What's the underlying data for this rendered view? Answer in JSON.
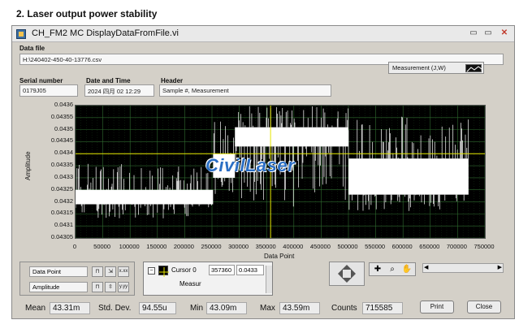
{
  "doc": {
    "heading": "2.   Laser output power stability"
  },
  "window": {
    "title": "CH_FM2 MC DisplayDataFromFile.vi",
    "minimize_glyph": "▭",
    "maximize_glyph": "▭",
    "close_glyph": "✕"
  },
  "data_file": {
    "label": "Data file",
    "path": "H:\\240402-450-40-13776.csv"
  },
  "info": {
    "serial_label": "Serial number",
    "serial": "0179J05",
    "date_label": "Date and Time",
    "date": "2024 四月 02 12:29",
    "header_label": "Header",
    "header": "Sample #, Measurement"
  },
  "plot_legend": {
    "label": "Measurement (J,W)"
  },
  "watermark": "CivilLaser",
  "chart_data": {
    "type": "line",
    "xlabel": "Data Point",
    "ylabel": "Amplitude",
    "xlim": [
      0,
      750000
    ],
    "ylim": [
      0.04305,
      0.0436
    ],
    "x_ticks": [
      "0",
      "50000",
      "100000",
      "150000",
      "200000",
      "250000",
      "300000",
      "350000",
      "400000",
      "450000",
      "500000",
      "550000",
      "600000",
      "650000",
      "700000",
      "750000"
    ],
    "y_ticks": [
      "0.0436",
      "0.04355",
      "0.0435",
      "0.04345",
      "0.0434",
      "0.04335",
      "0.0433",
      "0.04325",
      "0.0432",
      "0.04315",
      "0.0431",
      "0.04305"
    ],
    "grid": true,
    "cursor": {
      "x": 357360,
      "y": 0.0434
    },
    "series": [
      {
        "color": "#ffffff",
        "segments": [
          {
            "x": [
              0,
              252000
            ],
            "range": [
              0.04313,
              0.04336
            ],
            "dense": [
              0.04319,
              0.04325
            ]
          },
          {
            "x": [
              252000,
              292000
            ],
            "range": [
              0.04322,
              0.04354
            ],
            "dense": [
              0.0433,
              0.0434
            ]
          },
          {
            "x": [
              292000,
              500000
            ],
            "range": [
              0.04318,
              0.0436
            ],
            "dense": [
              0.04343,
              0.04351
            ]
          },
          {
            "x": [
              500000,
              720000
            ],
            "range": [
              0.04316,
              0.04356
            ],
            "dense": [
              0.04323,
              0.04338
            ]
          }
        ]
      }
    ]
  },
  "scale_legend": {
    "x_name": "Data Point",
    "y_name": "Amplitude"
  },
  "cursor_legend": {
    "name": "Cursor 0",
    "x_value": "357360",
    "y_value": "0.0433",
    "plot": "Measur"
  },
  "stats": {
    "mean_label": "Mean",
    "mean": "43.31m",
    "std_label": "Std. Dev.",
    "std": "94.55u",
    "min_label": "Min",
    "min": "43.09m",
    "max_label": "Max",
    "max": "43.59m",
    "counts_label": "Counts",
    "counts": "715585"
  },
  "buttons": {
    "print": "Print",
    "close": "Close"
  }
}
